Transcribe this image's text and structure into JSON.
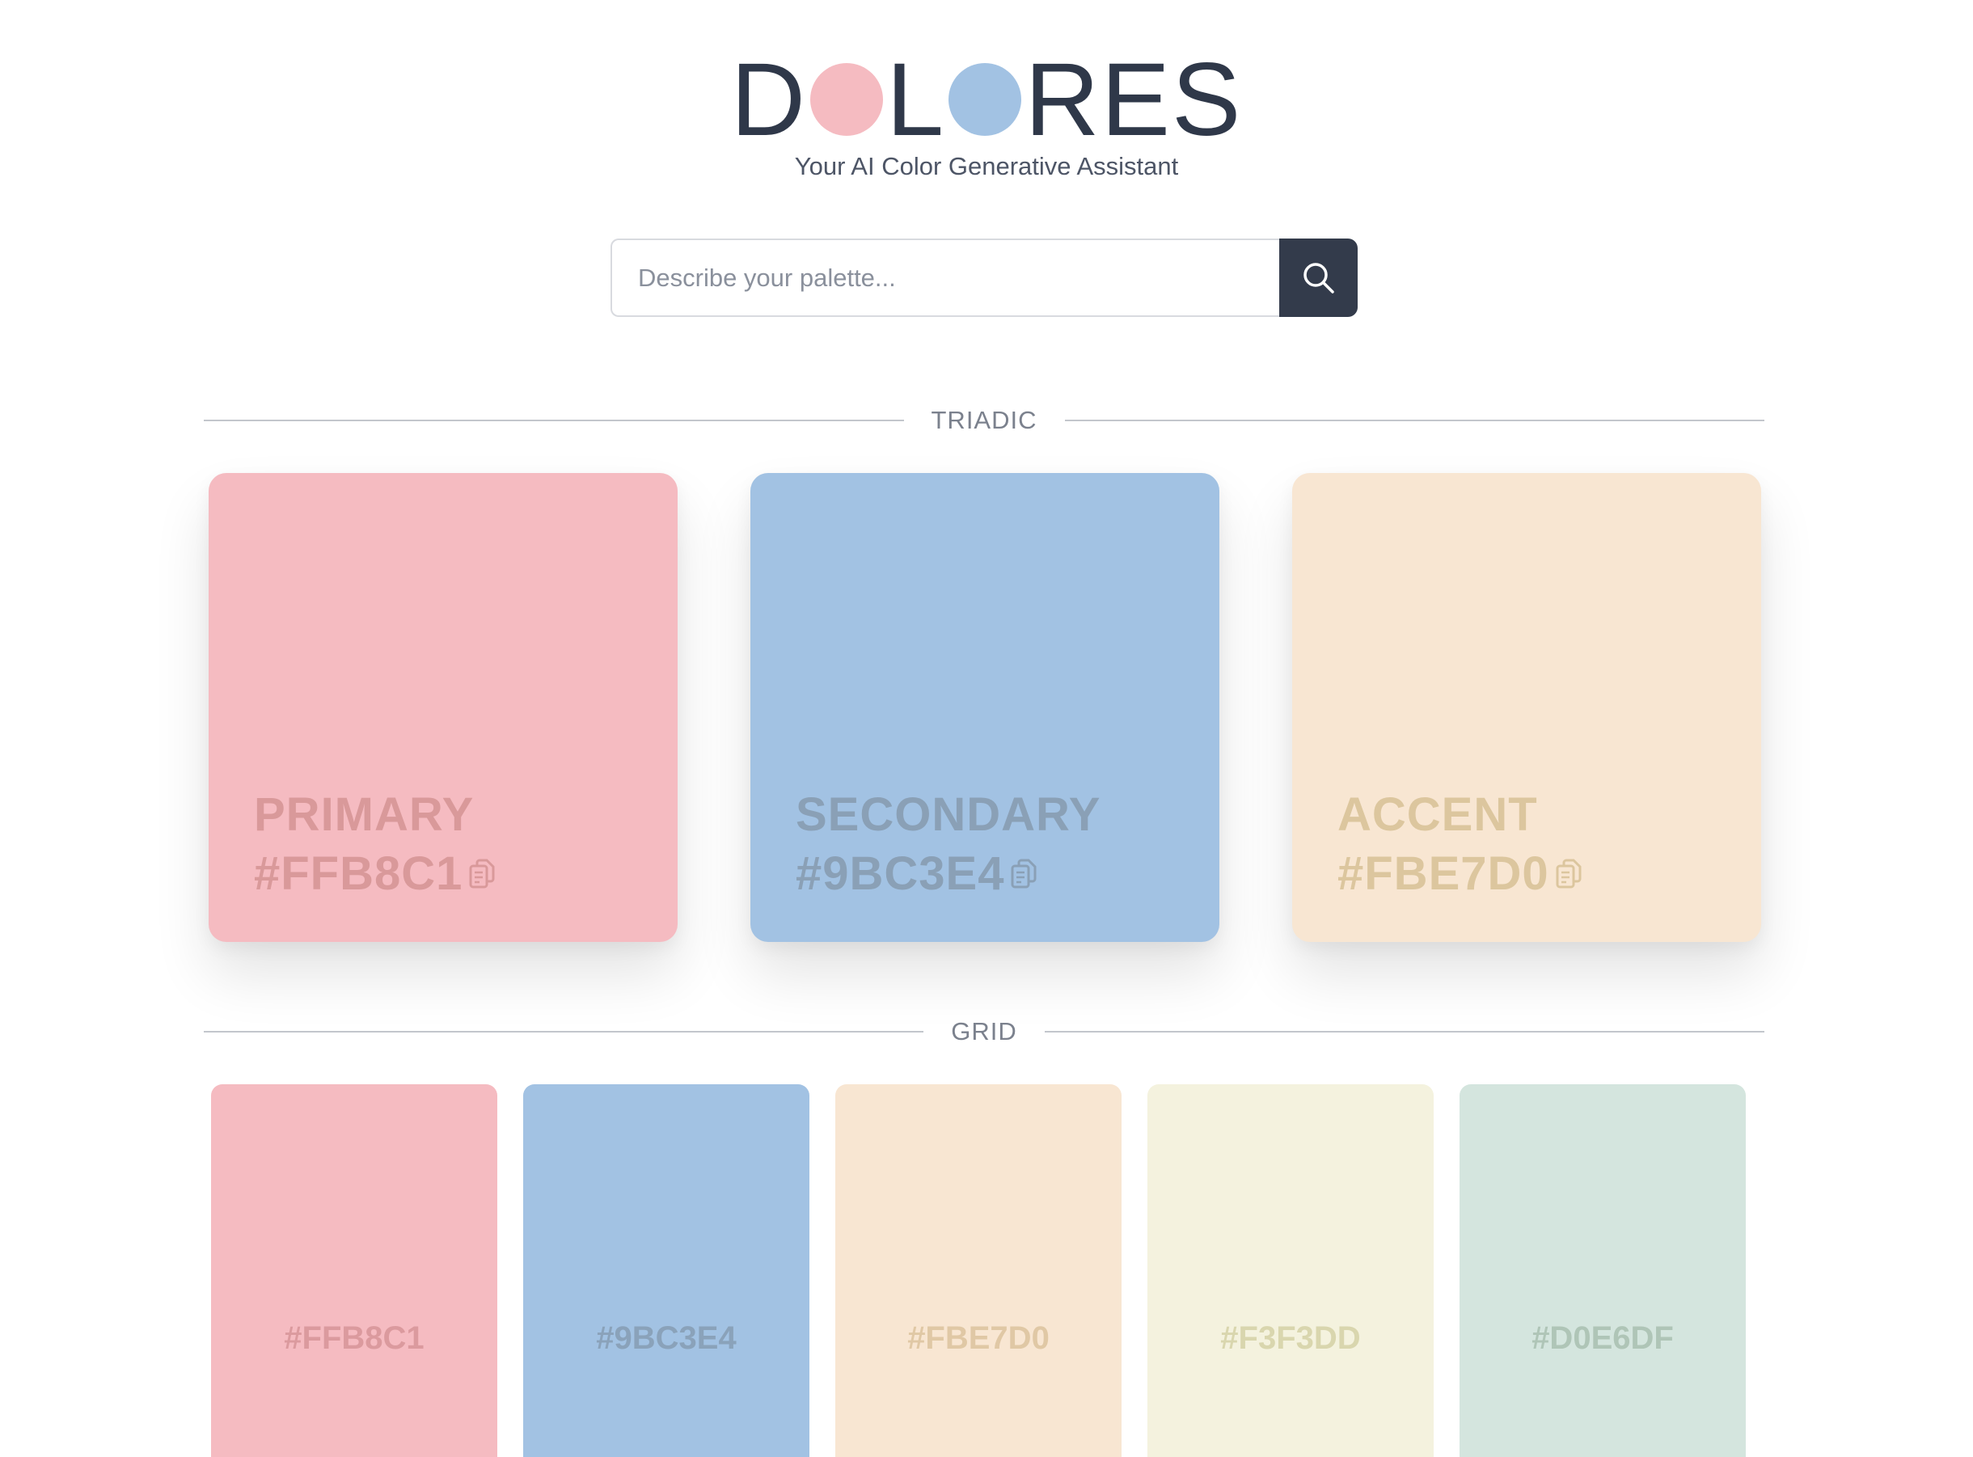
{
  "header": {
    "logo_letters": [
      "D",
      "L",
      "RES"
    ],
    "logo_dot_colors": [
      "#F5BBC1",
      "#A2C2E3"
    ],
    "tagline": "Your AI Color Generative Assistant"
  },
  "search": {
    "placeholder": "Describe your palette...",
    "value": "",
    "button_icon": "search-icon"
  },
  "sections": {
    "triadic_title": "TRIADIC",
    "grid_title": "GRID"
  },
  "triadic": [
    {
      "role": "PRIMARY",
      "hex": "#FFB8C1",
      "bg": "#F5BBC1",
      "text_color": "#D9999A",
      "icon": "copy-icon"
    },
    {
      "role": "SECONDARY",
      "hex": "#9BC3E4",
      "bg": "#A2C2E3",
      "text_color": "#8AA0B6",
      "icon": "copy-icon"
    },
    {
      "role": "ACCENT",
      "hex": "#FBE7D0",
      "bg": "#F8E6D2",
      "text_color": "#DCC69E",
      "icon": "copy-icon"
    }
  ],
  "grid": [
    {
      "hex": "#FFB8C1",
      "bg": "#F5BBC1",
      "text_color": "#DB9A9E"
    },
    {
      "hex": "#9BC3E4",
      "bg": "#A2C2E3",
      "text_color": "#8AA2BA"
    },
    {
      "hex": "#FBE7D0",
      "bg": "#F8E6D2",
      "text_color": "#E0C8A5"
    },
    {
      "hex": "#F3F3DD",
      "bg": "#F4F2DE",
      "text_color": "#D9D6AE"
    },
    {
      "hex": "#D0E6DF",
      "bg": "#D4E5DE",
      "text_color": "#AFC5B7"
    }
  ]
}
